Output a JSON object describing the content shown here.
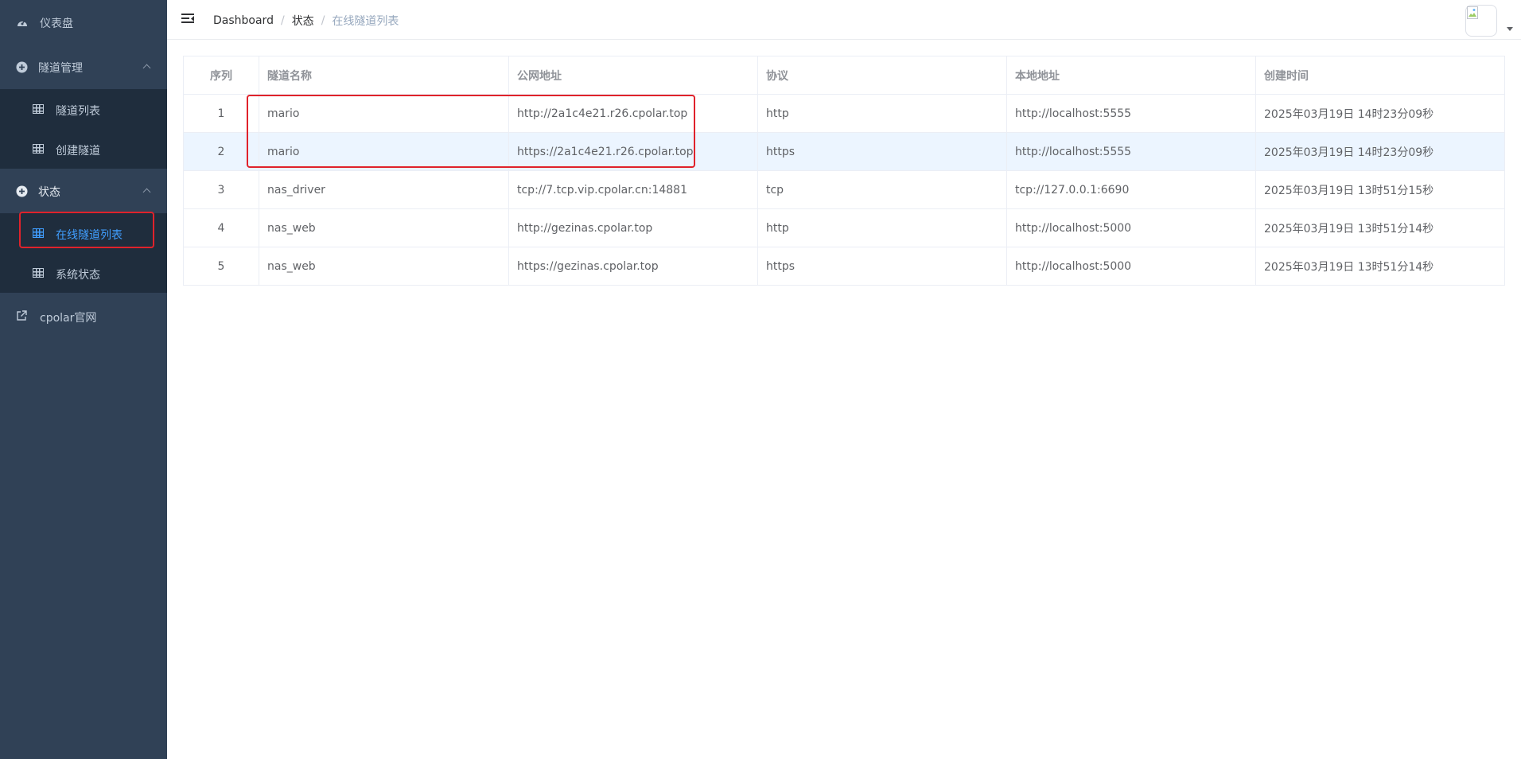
{
  "sidebar": {
    "items": [
      {
        "label": "仪表盘",
        "icon": "dashboard-icon"
      },
      {
        "label": "隧道管理",
        "icon": "plus-circle-icon",
        "expanded": true,
        "children": [
          {
            "label": "隧道列表",
            "icon": "grid-icon"
          },
          {
            "label": "创建隧道",
            "icon": "grid-icon"
          }
        ]
      },
      {
        "label": "状态",
        "icon": "plus-circle-icon",
        "expanded": true,
        "children": [
          {
            "label": "在线隧道列表",
            "icon": "grid-icon",
            "active": true
          },
          {
            "label": "系统状态",
            "icon": "grid-icon"
          }
        ]
      },
      {
        "label": "cpolar官网",
        "icon": "external-link-icon"
      }
    ],
    "colors": {
      "background": "#304156",
      "submenu": "#1f2d3d",
      "text": "#bfcbd9",
      "active": "#409eff"
    }
  },
  "header": {
    "breadcrumb": [
      "Dashboard",
      "状态",
      "在线隧道列表"
    ],
    "separator": "/"
  },
  "table": {
    "columns": [
      "序列",
      "隧道名称",
      "公网地址",
      "协议",
      "本地地址",
      "创建时间"
    ],
    "rows": [
      [
        "1",
        "mario",
        "http://2a1c4e21.r26.cpolar.top",
        "http",
        "http://localhost:5555",
        "2025年03月19日 14时23分09秒"
      ],
      [
        "2",
        "mario",
        "https://2a1c4e21.r26.cpolar.top",
        "https",
        "http://localhost:5555",
        "2025年03月19日 14时23分09秒"
      ],
      [
        "3",
        "nas_driver",
        "tcp://7.tcp.vip.cpolar.cn:14881",
        "tcp",
        "tcp://127.0.0.1:6690",
        "2025年03月19日 13时51分15秒"
      ],
      [
        "4",
        "nas_web",
        "http://gezinas.cpolar.top",
        "http",
        "http://localhost:5000",
        "2025年03月19日 13时51分14秒"
      ],
      [
        "5",
        "nas_web",
        "https://gezinas.cpolar.top",
        "https",
        "http://localhost:5000",
        "2025年03月19日 13时51分14秒"
      ]
    ],
    "highlighted_row": 2
  },
  "annotation_color": "#e0222b"
}
